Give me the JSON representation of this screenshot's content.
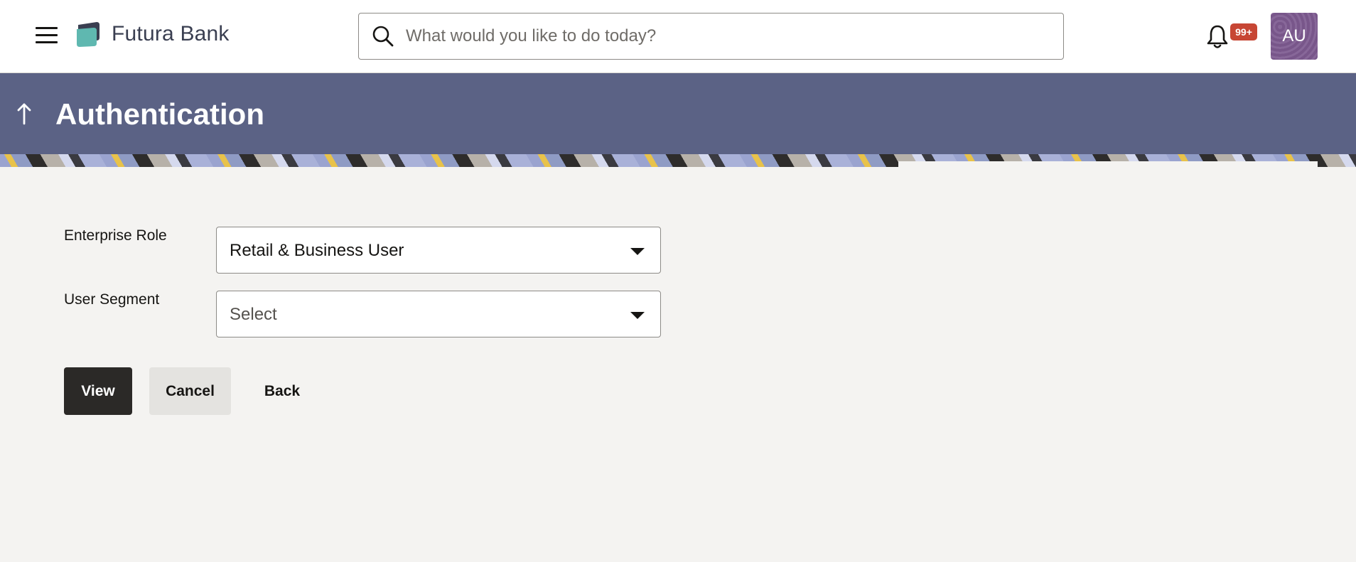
{
  "header": {
    "bank_name": "Futura Bank",
    "search_placeholder": "What would you like to do today?",
    "notification_count": "99+",
    "avatar_initials": "AU"
  },
  "banner": {
    "title": "Authentication"
  },
  "form": {
    "enterprise_role": {
      "label": "Enterprise Role",
      "value": "Retail & Business User"
    },
    "user_segment": {
      "label": "User Segment",
      "value": "Select"
    }
  },
  "actions": {
    "view": "View",
    "cancel": "Cancel",
    "back": "Back"
  },
  "colors": {
    "banner": "#5b6285",
    "primary_button": "#2b2927",
    "badge": "#c74634",
    "avatar": "#7d5a90"
  }
}
